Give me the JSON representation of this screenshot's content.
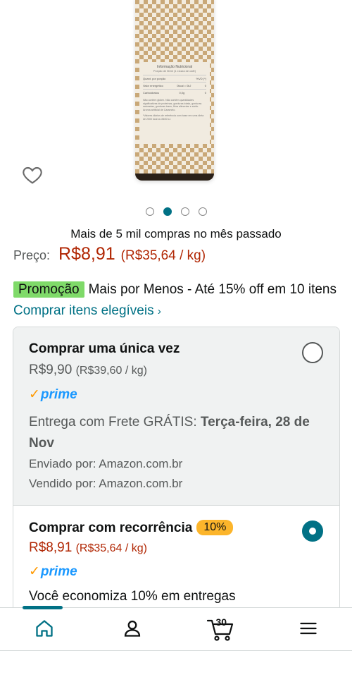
{
  "product": {
    "nutrition_title": "Informação Nutricional",
    "nutrition_portion": "Porção de 50ml (1 xícara de café)",
    "nutrition_header_left": "Quant. por porção",
    "nutrition_header_right": "%VD (*)",
    "nutrition_row1_left": "Valor energético",
    "nutrition_row1_mid": "0kcal = 0kJ",
    "nutrition_row1_right": "0",
    "nutrition_row2_left": "Carboidratos",
    "nutrition_row2_mid": "0,0g",
    "nutrition_row2_right": "0",
    "nutrition_note": "Não contém glúten. Não contém quantidades significativas de proteínas, gorduras totais, gorduras saturadas, gorduras trans, fibra alimentar e sódio. Aroma artificial de Caramelo.",
    "nutrition_footnote": "*Valores diários de referência com base em uma dieta de 2000 kcal ou 8400 kJ."
  },
  "carousel": {
    "count": 4,
    "active_index": 1
  },
  "social_proof": "Mais de 5 mil compras no mês passado",
  "price": {
    "label": "Preço:",
    "value": "R$8,91",
    "unit": "(R$35,64 / kg)"
  },
  "promotion": {
    "badge": "Promoção",
    "text": "Mais por Menos - Até 15% off em 10 itens",
    "link": "Comprar itens elegíveis",
    "link_chevron": "›"
  },
  "purchase_options": {
    "one_time": {
      "title": "Comprar uma única vez",
      "price": "R$9,90",
      "unit": "(R$39,60 / kg)",
      "prime": "prime",
      "delivery_prefix": "Entrega com Frete GRÁTIS:",
      "delivery_date": "Terça-feira, 28 de Nov",
      "shipped_by": "Enviado por: Amazon.com.br",
      "sold_by": "Vendido por: Amazon.com.br",
      "selected": false
    },
    "subscribe": {
      "title": "Comprar com recorrência",
      "badge": "10%",
      "price": "R$8,91",
      "unit": "(R$35,64 / kg)",
      "prime": "prime",
      "savings": "Você economiza 10% em entregas",
      "selected": true
    }
  },
  "tabbar": {
    "active": "home",
    "cart_count": "30",
    "items": [
      "home-icon",
      "account-icon",
      "cart-icon",
      "menu-icon"
    ]
  },
  "colors": {
    "accent": "#017185",
    "price": "#b12704",
    "promo_badge": "#7fda69",
    "prime_blue": "#1a98ff",
    "discount_badge": "#fcb52b"
  }
}
